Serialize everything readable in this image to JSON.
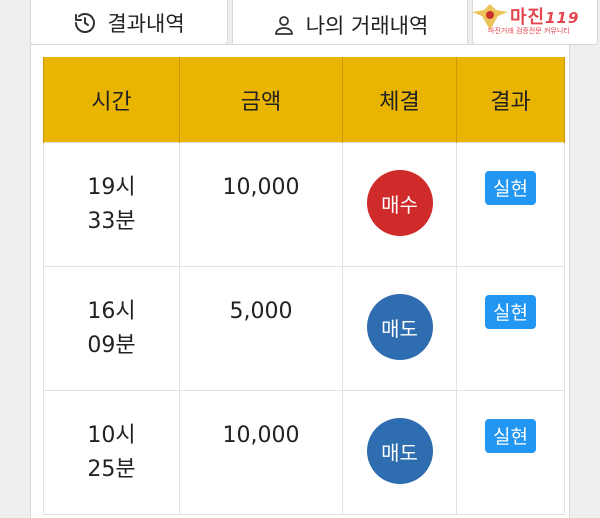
{
  "tabs": [
    {
      "label": "결과내역",
      "icon": "history-icon"
    },
    {
      "label": "나의 거래내역",
      "icon": "user-icon"
    }
  ],
  "logo": {
    "main": "마진",
    "number": "119",
    "sub": "마진거래 검증전문 커뮤니티"
  },
  "table": {
    "headers": {
      "time": "시간",
      "amount": "금액",
      "execution": "체결",
      "result": "결과"
    },
    "rows": [
      {
        "hour": "19시",
        "minute": "33분",
        "amount": "10,000",
        "execution": "매수",
        "execution_color": "#cf2b2b",
        "result": "실현"
      },
      {
        "hour": "16시",
        "minute": "09분",
        "amount": "5,000",
        "execution": "매도",
        "execution_color": "#2e6db0",
        "result": "실현"
      },
      {
        "hour": "10시",
        "minute": "25분",
        "amount": "10,000",
        "execution": "매도",
        "execution_color": "#2e6db0",
        "result": "실현"
      }
    ]
  },
  "colors": {
    "header_bg": "#e9b500",
    "badge_bg": "#2196f3",
    "buy": "#cf2b2b",
    "sell": "#2e6db0"
  }
}
